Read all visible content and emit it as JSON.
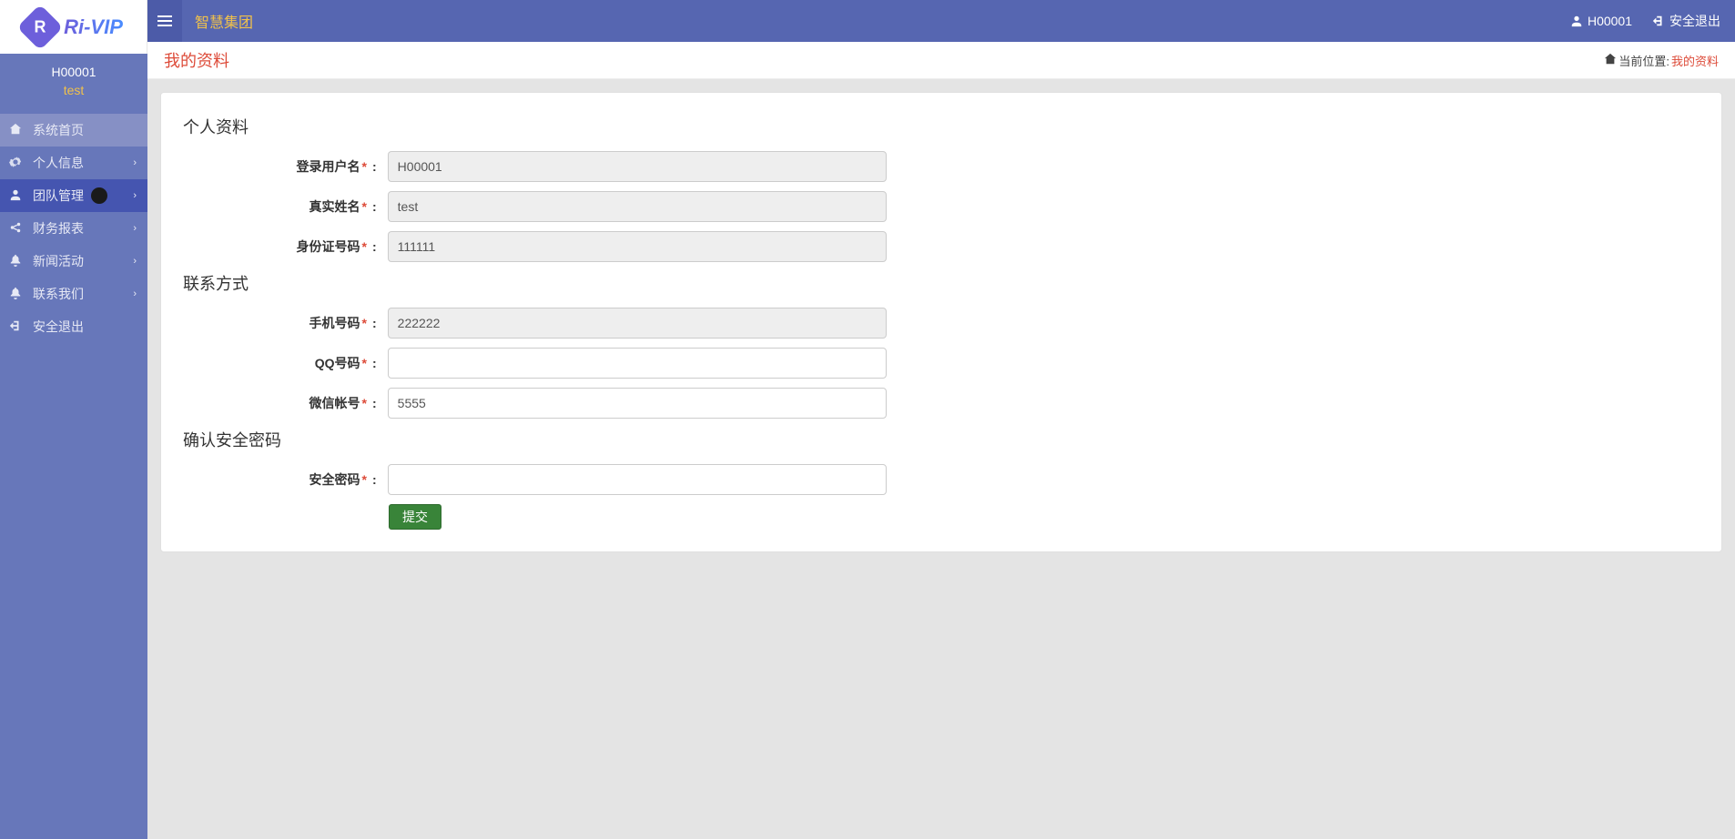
{
  "logo_text": "Ri-VIP",
  "user": {
    "id": "H00001",
    "name": "test"
  },
  "top": {
    "title": "智慧集团",
    "user_label": "H00001",
    "logout_label": "安全退出"
  },
  "nav": {
    "home": "系统首页",
    "profile": "个人信息",
    "team": "团队管理",
    "finance": "财务报表",
    "news": "新闻活动",
    "contact": "联系我们",
    "logout": "安全退出"
  },
  "page": {
    "title": "我的资料",
    "breadcrumb_label": "当前位置:",
    "breadcrumb_current": "我的资料"
  },
  "sections": {
    "personal": "个人资料",
    "contact": "联系方式",
    "confirm": "确认安全密码"
  },
  "fields": {
    "username": {
      "label": "登录用户名",
      "value": "H00001"
    },
    "realname": {
      "label": "真实姓名",
      "value": "test"
    },
    "idnumber": {
      "label": "身份证号码",
      "value": "111111"
    },
    "mobile": {
      "label": "手机号码",
      "value": "222222"
    },
    "qq": {
      "label": "QQ号码",
      "value": ""
    },
    "wechat": {
      "label": "微信帐号",
      "value": "5555"
    },
    "safepwd": {
      "label": "安全密码",
      "value": ""
    }
  },
  "submit_label": "提交",
  "req_mark": "*"
}
